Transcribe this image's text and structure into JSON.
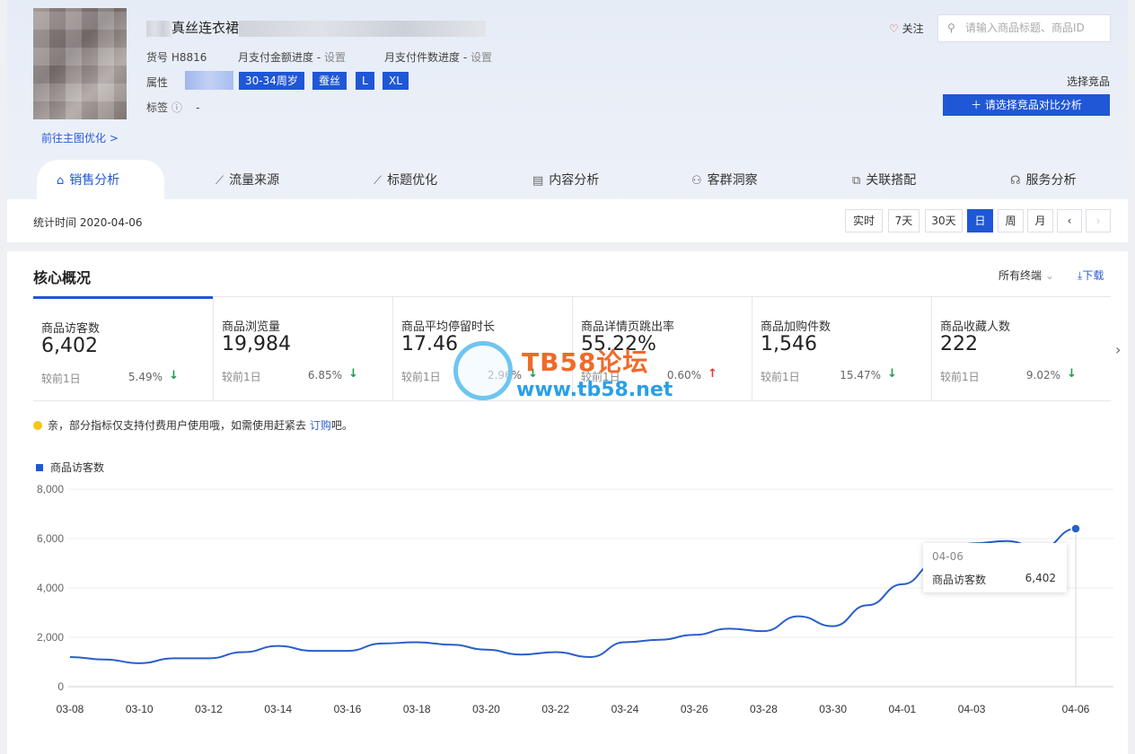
{
  "product": {
    "title": "真丝连衣裙",
    "sku_label": "货号",
    "sku": "H8816",
    "pay_amount_label": "月支付金额进度 -",
    "pay_amount_action": "设置",
    "pay_count_label": "月支付件数进度 -",
    "pay_count_action": "设置",
    "attr_label": "属性",
    "attrs": [
      "30-34周岁",
      "蚕丝",
      "L",
      "XL"
    ],
    "tags_label": "标签",
    "tags_value": "-",
    "main_image_link": "前往主图优化 >"
  },
  "header": {
    "follow_label": "关注",
    "search_placeholder": "请输入商品标题、商品ID",
    "choose_label": "选择竞品",
    "compare_button": "请选择竞品对比分析"
  },
  "tabs": [
    {
      "label": "销售分析",
      "icon": "bag-icon",
      "active": true
    },
    {
      "label": "流量来源",
      "icon": "line-chart-icon"
    },
    {
      "label": "标题优化",
      "icon": "line-chart-icon"
    },
    {
      "label": "内容分析",
      "icon": "document-icon"
    },
    {
      "label": "客群洞察",
      "icon": "users-icon"
    },
    {
      "label": "关联搭配",
      "icon": "link-icon"
    },
    {
      "label": "服务分析",
      "icon": "headset-icon"
    }
  ],
  "datebar": {
    "stat_time": "统计时间 2020-04-06",
    "periods": [
      "实时",
      "7天",
      "30天",
      "日",
      "周",
      "月"
    ],
    "active_period": "日",
    "prev": "‹",
    "next": "›"
  },
  "overview": {
    "title": "核心概况",
    "terminal": "所有终端",
    "download": "下载",
    "metrics": [
      {
        "label": "商品访客数",
        "value": "6,402",
        "compare": "较前1日",
        "pct": "5.49%",
        "dir": "down"
      },
      {
        "label": "商品浏览量",
        "value": "19,984",
        "compare": "较前1日",
        "pct": "6.85%",
        "dir": "down"
      },
      {
        "label": "商品平均停留时长",
        "value": "17.46",
        "compare": "较前1日",
        "pct": "2.96%",
        "dir": "down"
      },
      {
        "label": "商品详情页跳出率",
        "value": "55.22%",
        "compare": "较前1日",
        "pct": "0.60%",
        "dir": "up"
      },
      {
        "label": "商品加购件数",
        "value": "1,546",
        "compare": "较前1日",
        "pct": "15.47%",
        "dir": "down"
      },
      {
        "label": "商品收藏人数",
        "value": "222",
        "compare": "较前1日",
        "pct": "9.02%",
        "dir": "down"
      }
    ],
    "notice_text": "亲，部分指标仅支持付费用户使用哦，如需使用赶紧去",
    "notice_link": "订购",
    "notice_tail": "吧。"
  },
  "watermark": {
    "line1": "TB58论坛",
    "line2": "www.tb58.net"
  },
  "tooltip": {
    "date": "04-06",
    "name": "商品访客数",
    "value": "6,402"
  },
  "colors": {
    "accent": "#1f57d6",
    "down": "#1a9a4a",
    "up": "#e0393e"
  },
  "chart_data": {
    "type": "line",
    "series": [
      {
        "name": "商品访客数",
        "x": [
          "03-08",
          "03-09",
          "03-10",
          "03-11",
          "03-12",
          "03-13",
          "03-14",
          "03-15",
          "03-16",
          "03-17",
          "03-18",
          "03-19",
          "03-20",
          "03-21",
          "03-22",
          "03-23",
          "03-24",
          "03-25",
          "03-26",
          "03-27",
          "03-28",
          "03-29",
          "03-30",
          "03-31",
          "04-01",
          "04-02",
          "04-03",
          "04-04",
          "04-05",
          "04-06"
        ],
        "values": [
          1200,
          1100,
          950,
          1150,
          1150,
          1400,
          1650,
          1450,
          1450,
          1750,
          1800,
          1700,
          1500,
          1300,
          1400,
          1200,
          1800,
          1900,
          2100,
          2350,
          2250,
          2850,
          2450,
          3300,
          4150,
          5050,
          5800,
          5900,
          5600,
          6402
        ]
      }
    ],
    "xticks": [
      "03-08",
      "03-10",
      "03-12",
      "03-14",
      "03-16",
      "03-18",
      "03-20",
      "03-22",
      "03-24",
      "03-26",
      "03-28",
      "03-30",
      "04-01",
      "04-03",
      "04-06"
    ],
    "yticks": [
      "0",
      "2,000",
      "4,000",
      "6,000",
      "8,000"
    ],
    "ylim": [
      0,
      8000
    ],
    "grid": true,
    "legend": "top-left"
  }
}
